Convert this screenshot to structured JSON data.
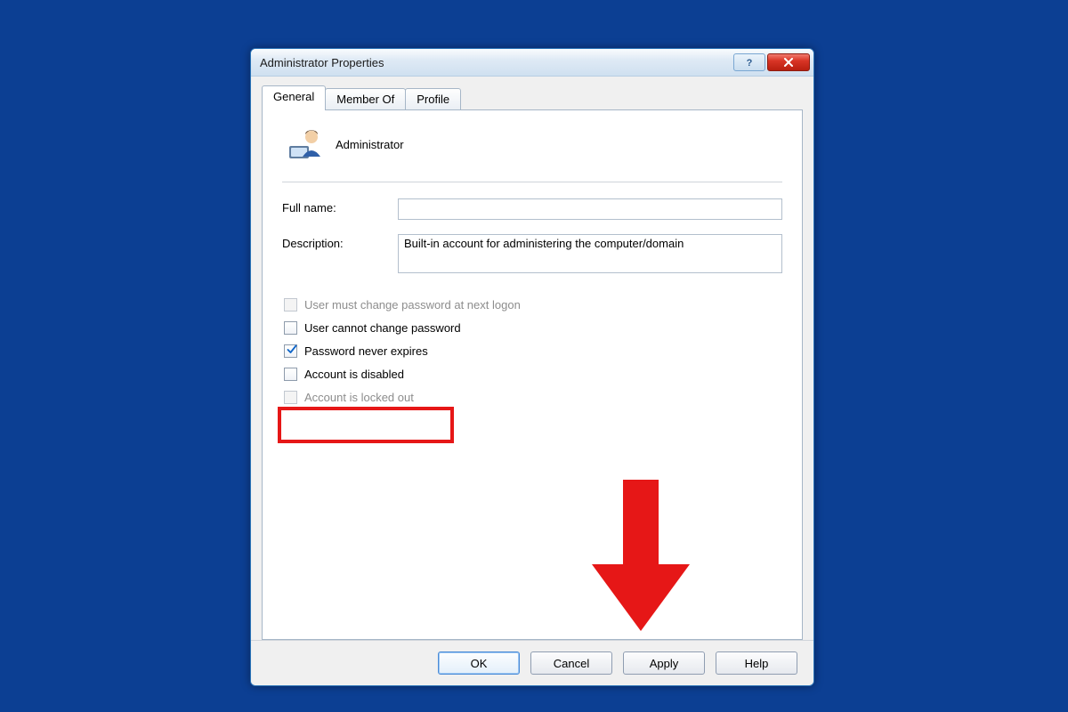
{
  "window": {
    "title": "Administrator Properties"
  },
  "tabs": {
    "general": "General",
    "member_of": "Member Of",
    "profile": "Profile"
  },
  "header": {
    "username": "Administrator"
  },
  "fields": {
    "full_name_label": "Full name:",
    "full_name_value": "",
    "description_label": "Description:",
    "description_value": "Built-in account for administering the computer/domain"
  },
  "checks": {
    "must_change": "User must change password at next logon",
    "cannot_change": "User cannot change password",
    "never_expires": "Password never expires",
    "disabled": "Account is disabled",
    "locked_out": "Account is locked out"
  },
  "buttons": {
    "ok": "OK",
    "cancel": "Cancel",
    "apply": "Apply",
    "help": "Help"
  },
  "colors": {
    "desktop": "#0c3f93",
    "highlight": "#e61717"
  }
}
